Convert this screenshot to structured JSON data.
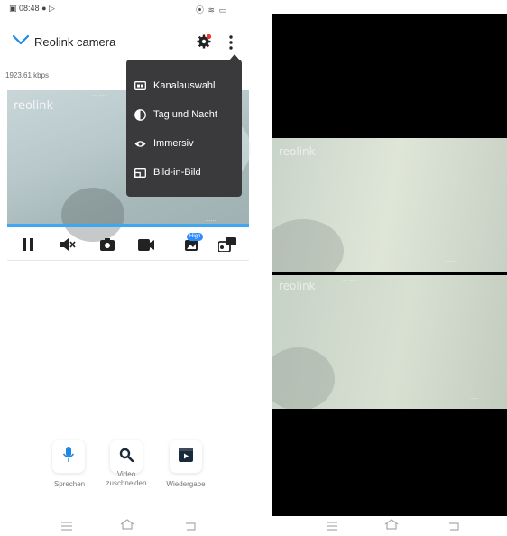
{
  "status_bar": {
    "time": "08:48"
  },
  "header": {
    "title": "Reolink camera"
  },
  "stream": {
    "bitrate": "1923.61 kbps",
    "watermark": "reolink"
  },
  "menu": {
    "items": [
      {
        "label": "Kanalauswahl",
        "icon": "channel-icon"
      },
      {
        "label": "Tag und Nacht",
        "icon": "day-night-icon"
      },
      {
        "label": "Immersiv",
        "icon": "eye-icon"
      },
      {
        "label": "Bild-in-Bild",
        "icon": "picture-in-picture-icon"
      }
    ]
  },
  "controls": {
    "icons": [
      "pause-icon",
      "mute-icon",
      "snapshot-icon",
      "record-icon",
      "quality-icon",
      "multi-view-icon"
    ],
    "quality_badge": "High"
  },
  "actions": [
    {
      "label": "Sprechen",
      "icon": "microphone-icon"
    },
    {
      "label": "Video zuschneiden",
      "label_line1": "Video",
      "label_line2": "zuschneiden",
      "icon": "search-icon"
    },
    {
      "label": "Wiedergabe",
      "icon": "playback-icon"
    }
  ],
  "colors": {
    "accent": "#1e88e5",
    "menu_bg": "#3a3a3c",
    "progress": "#3fa7f0",
    "badge": "#2f8cff"
  }
}
